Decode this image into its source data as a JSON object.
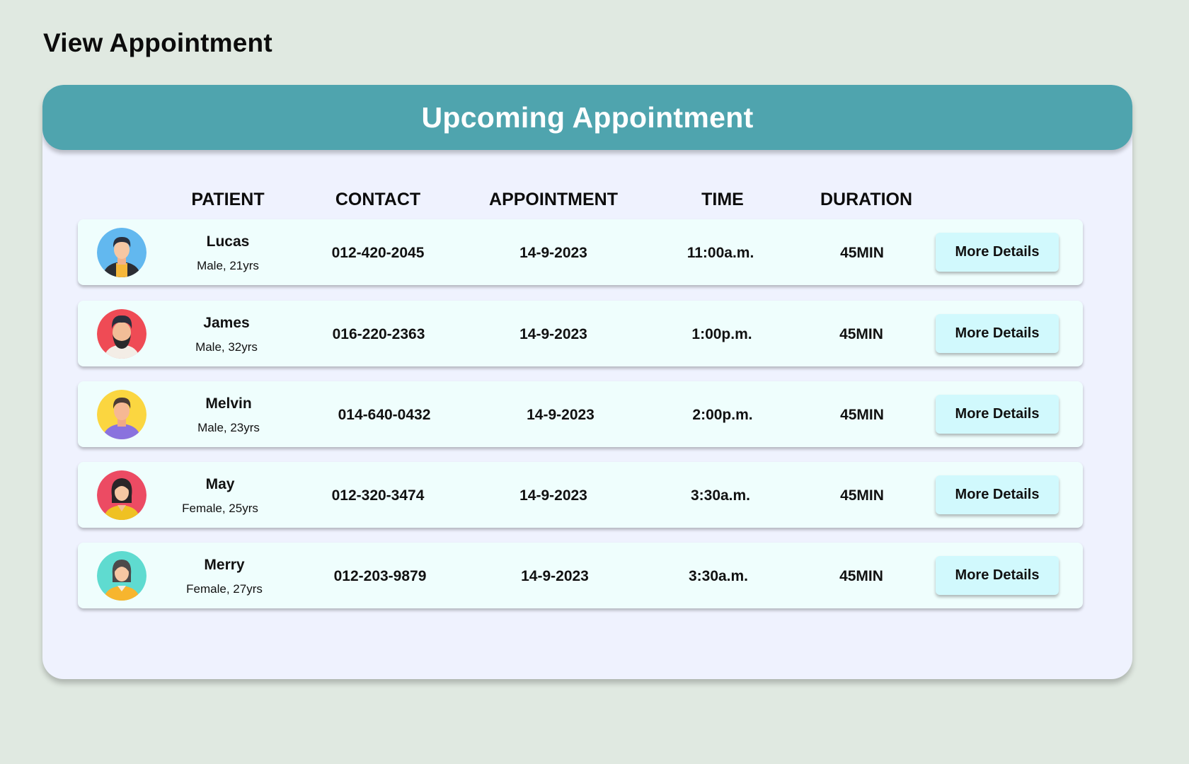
{
  "page": {
    "title": "View Appointment"
  },
  "card": {
    "title": "Upcoming Appointment"
  },
  "columns": {
    "patient": "PATIENT",
    "contact": "CONTACT",
    "appointment": "APPOINTMENT",
    "time": "TIME",
    "duration": "DURATION"
  },
  "rows": [
    {
      "name": "Lucas",
      "info": "Male, 21yrs",
      "contact": "012-420-2045",
      "date": "14-9-2023",
      "time": "11:00a.m.",
      "duration": "45MIN",
      "button": "More Details",
      "avatar": "male-avatar-blue-icon"
    },
    {
      "name": "James",
      "info": "Male, 32yrs",
      "contact": "016-220-2363",
      "date": "14-9-2023",
      "time": "1:00p.m.",
      "duration": "45MIN",
      "button": "More Details",
      "avatar": "bearded-male-avatar-red-icon"
    },
    {
      "name": "Melvin",
      "info": "Male, 23yrs",
      "contact": "014-640-0432",
      "date": "14-9-2023",
      "time": "2:00p.m.",
      "duration": "45MIN",
      "button": "More Details",
      "avatar": "male-avatar-yellow-icon"
    },
    {
      "name": "May",
      "info": "Female, 25yrs",
      "contact": "012-320-3474",
      "date": "14-9-2023",
      "time": "3:30a.m.",
      "duration": "45MIN",
      "button": "More Details",
      "avatar": "female-avatar-red-icon"
    },
    {
      "name": "Merry",
      "info": "Female, 27yrs",
      "contact": "012-203-9879",
      "date": "14-9-2023",
      "time": "3:30a.m.",
      "duration": "45MIN",
      "button": "More Details",
      "avatar": "female-avatar-teal-icon"
    }
  ],
  "colors": {
    "background": "#e0e9e1",
    "card": "#eff2fe",
    "header": "#4fa4ae",
    "row": "#effefd",
    "button": "#d1f9fd"
  }
}
